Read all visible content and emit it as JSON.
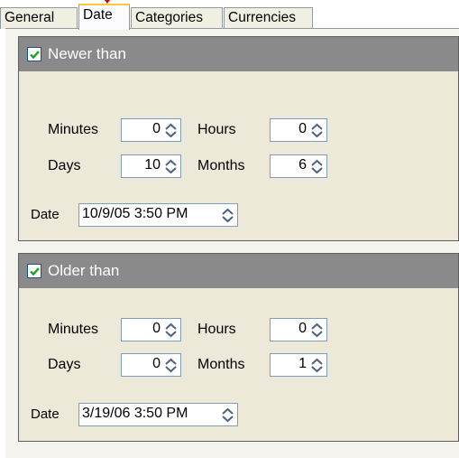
{
  "tabs": [
    {
      "label": "General",
      "active": false
    },
    {
      "label": "Date",
      "active": true
    },
    {
      "label": "Categories",
      "active": false
    },
    {
      "label": "Currencies",
      "active": false
    }
  ],
  "newer": {
    "title": "Newer than",
    "checked": true,
    "minutes_label": "Minutes",
    "minutes_value": "0",
    "hours_label": "Hours",
    "hours_value": "0",
    "days_label": "Days",
    "days_value": "10",
    "months_label": "Months",
    "months_value": "6",
    "date_label": "Date",
    "date_value": "10/9/05 3:50 PM"
  },
  "older": {
    "title": "Older than",
    "checked": true,
    "minutes_label": "Minutes",
    "minutes_value": "0",
    "hours_label": "Hours",
    "hours_value": "0",
    "days_label": "Days",
    "days_value": "0",
    "months_label": "Months",
    "months_value": "1",
    "date_label": "Date",
    "date_value": "3/19/06 3:50 PM"
  },
  "colors": {
    "group_header": "#8a8a8a",
    "panel_bg": "#ece9d8",
    "check_green": "#21a121",
    "spinner_arrow": "#4d6185"
  },
  "icons": {
    "check": "checkmark-icon",
    "spin": "spin-arrows-icon"
  }
}
